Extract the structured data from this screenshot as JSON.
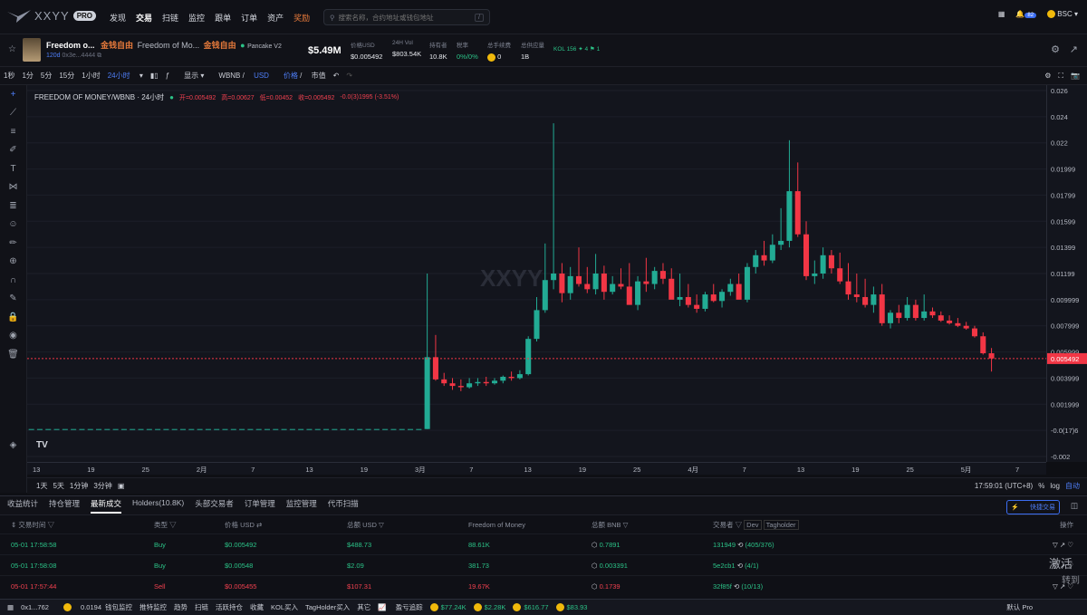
{
  "header": {
    "brand": "XXYY",
    "pro": "PRO",
    "nav": [
      "发现",
      "交易",
      "扫链",
      "监控",
      "跟单",
      "订单",
      "资产",
      "奖励"
    ],
    "active_nav": "交易",
    "search_placeholder": "搜索名称，合约地址或钱包地址",
    "search_shortcut": "/",
    "notif_count": "82",
    "chain": "BSC"
  },
  "token": {
    "short": "Freedom o...",
    "cn": "金钱自由",
    "full": "Freedom of Mo...",
    "cn2": "金钱自由",
    "dex": "Pancake V2",
    "age": "120d",
    "addr": "0x3e...4444",
    "mcap": "$5.49M",
    "stats": [
      {
        "label": "价格USD",
        "value": "$0.005492"
      },
      {
        "label": "24H Vol",
        "value": "$803.54K"
      },
      {
        "label": "持有者",
        "value": "10.8K"
      },
      {
        "label": "税率",
        "value": "0%/0%"
      },
      {
        "label": "总手续费",
        "value": "0"
      },
      {
        "label": "总供应量",
        "value": "1B"
      }
    ],
    "kol": "KOL 156",
    "kol_a": "4",
    "kol_b": "1"
  },
  "toolbar": {
    "intervals": [
      "1秒",
      "1分",
      "5分",
      "15分",
      "1小时",
      "24小时"
    ],
    "active": "24小时",
    "show": "显示",
    "pair_a": "WBNB",
    "pair_b": "USD",
    "mode_a": "价格",
    "mode_b": "市值"
  },
  "chart_data": {
    "type": "candlestick",
    "title": "FREEDOM OF MONEY/WBNB · 24小时",
    "ohlc": {
      "open_label": "开=0.005492",
      "high_label": "高=0.00627",
      "low_label": "低=0.00452",
      "close_label": "收=0.005492",
      "change": "-0.0(3)1995 (-3.51%)"
    },
    "yticks": [
      "0.026",
      "0.024",
      "0.022",
      "0.01999",
      "0.01799",
      "0.01599",
      "0.01399",
      "0.01199",
      "0.009999",
      "0.007999",
      "0.005999",
      "0.003999",
      "0.001999",
      "-0.0(17)6",
      "-0.002"
    ],
    "ylim": [
      -0.002,
      0.026
    ],
    "last_price": "0.005492",
    "xticks": [
      "13",
      "19",
      "25",
      "2月",
      "7",
      "13",
      "19",
      "3月",
      "7",
      "13",
      "19",
      "25",
      "4月",
      "7",
      "13",
      "19",
      "25",
      "5月",
      "7"
    ],
    "watermark": "XXYY",
    "candles": [
      [
        0.0001,
        0.0001,
        0.0001,
        0.0001
      ],
      [
        0.0001,
        0.0001,
        0.0001,
        0.0001
      ],
      [
        0.0001,
        0.0001,
        0.0001,
        0.0001
      ],
      [
        0.0001,
        0.0001,
        0.0001,
        0.0001
      ],
      [
        0.0001,
        0.0001,
        0.0001,
        0.0001
      ],
      [
        0.0001,
        0.0001,
        0.0001,
        0.0001
      ],
      [
        0.0001,
        0.0001,
        0.0001,
        0.0001
      ],
      [
        0.0001,
        0.0001,
        0.0001,
        0.0001
      ],
      [
        0.0001,
        0.0001,
        0.0001,
        0.0001
      ],
      [
        0.0001,
        0.0001,
        0.0001,
        0.0001
      ],
      [
        0.0001,
        0.0001,
        0.0001,
        0.0001
      ],
      [
        0.0001,
        0.0001,
        0.0001,
        0.0001
      ],
      [
        0.0001,
        0.0001,
        0.0001,
        0.0001
      ],
      [
        0.0001,
        0.0001,
        0.0001,
        0.0001
      ],
      [
        0.0001,
        0.0001,
        0.0001,
        0.0001
      ],
      [
        0.0001,
        0.0001,
        0.0001,
        0.0001
      ],
      [
        0.0001,
        0.0001,
        0.0001,
        0.0001
      ],
      [
        0.0001,
        0.0001,
        0.0001,
        0.0001
      ],
      [
        0.0001,
        0.0001,
        0.0001,
        0.0001
      ],
      [
        0.0001,
        0.0001,
        0.0001,
        0.0001
      ],
      [
        0.0001,
        0.0001,
        0.0001,
        0.0001
      ],
      [
        0.0001,
        0.0001,
        0.0001,
        0.0001
      ],
      [
        0.0001,
        0.0001,
        0.0001,
        0.0001
      ],
      [
        0.0001,
        0.0001,
        0.0001,
        0.0001
      ],
      [
        0.0001,
        0.0001,
        0.0001,
        0.0001
      ],
      [
        0.0001,
        0.0001,
        0.0001,
        0.0001
      ],
      [
        0.0001,
        0.0001,
        0.0001,
        0.0001
      ],
      [
        0.0001,
        0.0001,
        0.0001,
        0.0001
      ],
      [
        0.0001,
        0.0001,
        0.0001,
        0.0001
      ],
      [
        0.0001,
        0.0001,
        0.0001,
        0.0001
      ],
      [
        0.0001,
        0.0001,
        0.0001,
        0.0001
      ],
      [
        0.0001,
        0.0001,
        0.0001,
        0.0001
      ],
      [
        0.0001,
        0.0001,
        0.0001,
        0.0001
      ],
      [
        0.0001,
        0.0001,
        0.0001,
        0.0001
      ],
      [
        0.0001,
        0.0001,
        0.0001,
        0.0001
      ],
      [
        0.0001,
        0.0001,
        0.0001,
        0.0001
      ],
      [
        0.0001,
        0.0001,
        0.0001,
        0.0001
      ],
      [
        0.0001,
        0.0001,
        0.0001,
        0.0001
      ],
      [
        0.0001,
        0.0001,
        0.0001,
        0.0001
      ],
      [
        0.0001,
        0.0001,
        0.0001,
        0.0001
      ],
      [
        0.0001,
        0.0001,
        0.0001,
        0.0001
      ],
      [
        0.0001,
        0.0001,
        0.0001,
        0.0001
      ],
      [
        0.0001,
        0.0001,
        0.0001,
        0.0001
      ],
      [
        0.0001,
        0.0001,
        0.0001,
        0.0001
      ],
      [
        0.0001,
        0.0001,
        0.0001,
        0.0001
      ],
      [
        0.0001,
        0.0001,
        0.0001,
        0.0001
      ],
      [
        0.0001,
        0.0001,
        0.0001,
        0.0001
      ],
      [
        0.0001,
        0.012,
        0.0001,
        0.0056
      ],
      [
        0.0056,
        0.0073,
        0.0038,
        0.0039
      ],
      [
        0.0039,
        0.0044,
        0.0034,
        0.0036
      ],
      [
        0.0036,
        0.004,
        0.0031,
        0.0034
      ],
      [
        0.0034,
        0.0039,
        0.003,
        0.0033
      ],
      [
        0.0033,
        0.004,
        0.0032,
        0.0036
      ],
      [
        0.0036,
        0.004,
        0.0034,
        0.0037
      ],
      [
        0.0037,
        0.0041,
        0.0034,
        0.0036
      ],
      [
        0.0036,
        0.004,
        0.0035,
        0.0038
      ],
      [
        0.0038,
        0.0042,
        0.0036,
        0.0041
      ],
      [
        0.0041,
        0.0045,
        0.0038,
        0.004
      ],
      [
        0.004,
        0.0046,
        0.0039,
        0.0043
      ],
      [
        0.0043,
        0.0072,
        0.0042,
        0.007
      ],
      [
        0.007,
        0.0102,
        0.0068,
        0.0092
      ],
      [
        0.0092,
        0.0143,
        0.009,
        0.0115
      ],
      [
        0.0115,
        0.0235,
        0.0108,
        0.012
      ],
      [
        0.012,
        0.0128,
        0.0098,
        0.0105
      ],
      [
        0.0105,
        0.0125,
        0.01,
        0.0118
      ],
      [
        0.0118,
        0.014,
        0.011,
        0.0112
      ],
      [
        0.0112,
        0.0125,
        0.0105,
        0.0108
      ],
      [
        0.0108,
        0.0135,
        0.0104,
        0.012
      ],
      [
        0.012,
        0.0126,
        0.01,
        0.0106
      ],
      [
        0.0106,
        0.0118,
        0.0104,
        0.0112
      ],
      [
        0.0112,
        0.0124,
        0.0108,
        0.011
      ],
      [
        0.011,
        0.0128,
        0.0104,
        0.0096
      ],
      [
        0.0096,
        0.0118,
        0.0092,
        0.0114
      ],
      [
        0.0114,
        0.0132,
        0.0106,
        0.0112
      ],
      [
        0.0112,
        0.0125,
        0.0108,
        0.0122
      ],
      [
        0.0122,
        0.0128,
        0.0112,
        0.0116
      ],
      [
        0.0116,
        0.0124,
        0.0104,
        0.01
      ],
      [
        0.01,
        0.012,
        0.0095,
        0.0102
      ],
      [
        0.0102,
        0.0112,
        0.0094,
        0.0096
      ],
      [
        0.0096,
        0.0104,
        0.009,
        0.0093
      ],
      [
        0.0093,
        0.0106,
        0.0091,
        0.0104
      ],
      [
        0.0104,
        0.0112,
        0.0098,
        0.0099
      ],
      [
        0.0099,
        0.0108,
        0.0094,
        0.0106
      ],
      [
        0.0106,
        0.0116,
        0.0103,
        0.0112
      ],
      [
        0.0112,
        0.012,
        0.0102,
        0.01
      ],
      [
        0.01,
        0.0128,
        0.0098,
        0.0125
      ],
      [
        0.0125,
        0.0138,
        0.012,
        0.0134
      ],
      [
        0.0134,
        0.0145,
        0.0126,
        0.013
      ],
      [
        0.013,
        0.015,
        0.0128,
        0.0142
      ],
      [
        0.0142,
        0.017,
        0.0138,
        0.0145
      ],
      [
        0.0145,
        0.0222,
        0.014,
        0.0183
      ],
      [
        0.0183,
        0.0205,
        0.0148,
        0.015
      ],
      [
        0.015,
        0.016,
        0.0115,
        0.0118
      ],
      [
        0.0118,
        0.013,
        0.0112,
        0.012
      ],
      [
        0.012,
        0.014,
        0.0116,
        0.0134
      ],
      [
        0.0134,
        0.0138,
        0.012,
        0.0124
      ],
      [
        0.0124,
        0.0136,
        0.0112,
        0.0114
      ],
      [
        0.0114,
        0.0128,
        0.01,
        0.0104
      ],
      [
        0.0104,
        0.012,
        0.0098,
        0.0102
      ],
      [
        0.0102,
        0.0116,
        0.0094,
        0.0096
      ],
      [
        0.0096,
        0.011,
        0.009,
        0.0104
      ],
      [
        0.0104,
        0.0112,
        0.008,
        0.0082
      ],
      [
        0.0082,
        0.0092,
        0.0078,
        0.009
      ],
      [
        0.009,
        0.0096,
        0.0082,
        0.0086
      ],
      [
        0.0086,
        0.0102,
        0.0084,
        0.0096
      ],
      [
        0.0096,
        0.01,
        0.0084,
        0.0086
      ],
      [
        0.0086,
        0.0104,
        0.0084,
        0.0091
      ],
      [
        0.0091,
        0.0094,
        0.0086,
        0.0088
      ],
      [
        0.0088,
        0.0091,
        0.0083,
        0.0084
      ],
      [
        0.0084,
        0.0088,
        0.0081,
        0.0082
      ],
      [
        0.0082,
        0.0086,
        0.0079,
        0.008
      ],
      [
        0.008,
        0.0083,
        0.0077,
        0.0078
      ],
      [
        0.0078,
        0.008,
        0.0071,
        0.0072
      ],
      [
        0.0072,
        0.0075,
        0.0058,
        0.0059
      ],
      [
        0.0059,
        0.0063,
        0.0045,
        0.0055
      ]
    ]
  },
  "range": {
    "items": [
      "1天",
      "5天",
      "1分钟",
      "3分钟"
    ],
    "time": "17:59:01 (UTC+8)",
    "pct": "%",
    "log": "log",
    "auto": "自动"
  },
  "tabs": {
    "items": [
      "收益统计",
      "持仓管理",
      "最新成交",
      "Holders(10.8K)",
      "头部交易者",
      "订单管理",
      "监控管理",
      "代币扫描"
    ],
    "active": "最新成交",
    "quick": "快捷交易"
  },
  "trades": {
    "headers": [
      "交易时间",
      "类型",
      "价格 USD",
      "总额 USD",
      "Freedom of Money",
      "总额 BNB",
      "交易者",
      "操作"
    ],
    "dev": "Dev",
    "tagholder": "Tagholder",
    "rows": [
      {
        "time": "05-01 17:58:58",
        "type": "Buy",
        "price": "$0.005492",
        "usd": "$488.73",
        "amount": "88.61K",
        "bnb": "0.7891",
        "trader": "131949",
        "note": "(405/376)",
        "side": "buy"
      },
      {
        "time": "05-01 17:58:08",
        "type": "Buy",
        "price": "$0.00548",
        "usd": "$2.09",
        "amount": "381.73",
        "bnb": "0.003391",
        "trader": "5e2cb1",
        "note": "(4/1)",
        "side": "buy"
      },
      {
        "time": "05-01 17:57:44",
        "type": "Sell",
        "price": "$0.005455",
        "usd": "$107.31",
        "amount": "19.67K",
        "bnb": "0.1739",
        "trader": "32f85f",
        "note": "(10/13)",
        "side": "sell"
      }
    ]
  },
  "status": {
    "wallet": "0x1...762",
    "bal": "0.0194",
    "items": [
      "钱包监控",
      "推特监控",
      "趋势",
      "扫链",
      "活跃持仓",
      "收藏",
      "KOL买入",
      "TagHolder买入",
      "其它"
    ],
    "pnl": "盈亏追踪",
    "prices": [
      "$77.24K",
      "$2.28K",
      "$616.77",
      "$83.93"
    ],
    "mode": "默认 Pro"
  },
  "overlay": {
    "line1": "激活",
    "line2": "转到"
  }
}
